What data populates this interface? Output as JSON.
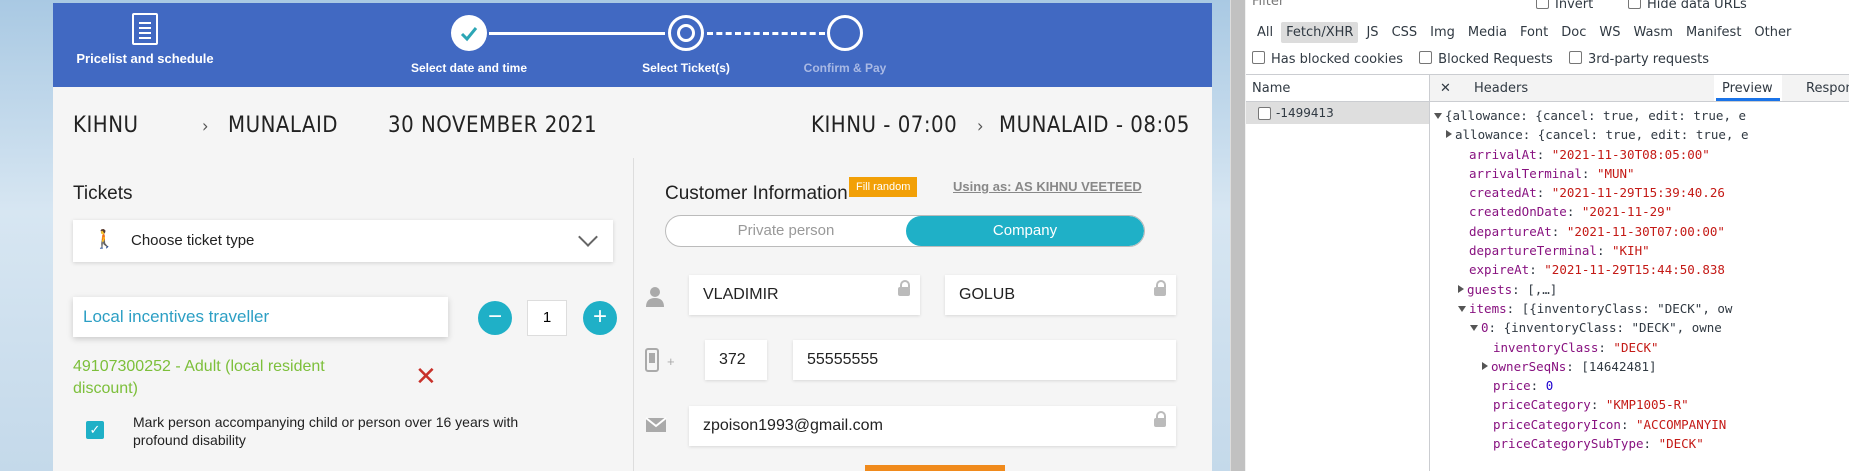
{
  "header": {
    "pricelist_label": "Pricelist and schedule",
    "steps": [
      {
        "label": "Select date and time"
      },
      {
        "label": "Select Ticket(s)"
      },
      {
        "label": "Confirm & Pay"
      }
    ]
  },
  "route": {
    "from": "KIHNU",
    "to": "MUNALAID",
    "date": "30 NOVEMBER 2021",
    "dep": "KIHNU - 07:00",
    "arr": "MUNALAID - 08:05",
    "sep": "›"
  },
  "tickets": {
    "title": "Tickets",
    "choose_label": "Choose ticket type",
    "traveller": "Local incentives traveller",
    "minus": "−",
    "plus": "+",
    "quantity": "1",
    "passenger": "49107300252 - Adult (local resident discount)",
    "remove": "✕",
    "checkbox_mark": "✓",
    "checkbox_label": "Mark person accompanying child or person over 16 years with profound disability"
  },
  "customer": {
    "title": "Customer Information",
    "fill_random": "Fill random",
    "using_as": "Using as: AS KIHNU VEETEED",
    "private_label": "Private person",
    "company_label": "Company",
    "first_name": "VLADIMIR",
    "last_name": "GOLUB",
    "phone_plus": "+",
    "phone_code": "372",
    "phone_number": "55555555",
    "email": "zpoison1993@gmail.com"
  },
  "devtools": {
    "filter_placeholder": "Filter",
    "invert_label": "Invert",
    "hide_data_urls_label": "Hide data URLs",
    "types": [
      "All",
      "Fetch/XHR",
      "JS",
      "CSS",
      "Img",
      "Media",
      "Font",
      "Doc",
      "WS",
      "Wasm",
      "Manifest",
      "Other"
    ],
    "selected_type": "Fetch/XHR",
    "opt_blocked_cookies": "Has blocked cookies",
    "opt_blocked_requests": "Blocked Requests",
    "opt_third_party": "3rd-party requests",
    "name_header": "Name",
    "request_name": "-1499413",
    "close_symbol": "✕",
    "tabs": {
      "headers": "Headers",
      "preview": "Preview",
      "response": "Response",
      "more": "»"
    },
    "json_lines": [
      {
        "text": "{allowance: {cancel: true, edit: true, e"
      },
      {
        "text": "allowance: {cancel: true, edit: true, e"
      },
      {
        "key": "arrivalAt",
        "val": "\"2021-11-30T08:05:00\""
      },
      {
        "key": "arrivalTerminal",
        "val": "\"MUN\""
      },
      {
        "key": "createdAt",
        "val": "\"2021-11-29T15:39:40.26"
      },
      {
        "key": "createdOnDate",
        "val": "\"2021-11-29\""
      },
      {
        "key": "departureAt",
        "val": "\"2021-11-30T07:00:00\""
      },
      {
        "key": "departureTerminal",
        "val": "\"KIH\""
      },
      {
        "key": "expireAt",
        "val": "\"2021-11-29T15:44:50.838"
      },
      {
        "key": "guests",
        "val": "[,…]"
      },
      {
        "key": "items",
        "val": "[{inventoryClass: \"DECK\", ow"
      },
      {
        "key": "0",
        "val": "{inventoryClass: \"DECK\", owne"
      },
      {
        "key": "inventoryClass",
        "val": "\"DECK\""
      },
      {
        "key": "ownerSeqNs",
        "val": "[14642481]"
      },
      {
        "key": "price",
        "val": "0"
      },
      {
        "key": "priceCategory",
        "val": "\"KMP1005-R\""
      },
      {
        "key": "priceCategoryIcon",
        "val": "\"ACCOMPANYIN"
      },
      {
        "key": "priceCategorySubType",
        "val": "\"DECK\""
      }
    ]
  }
}
